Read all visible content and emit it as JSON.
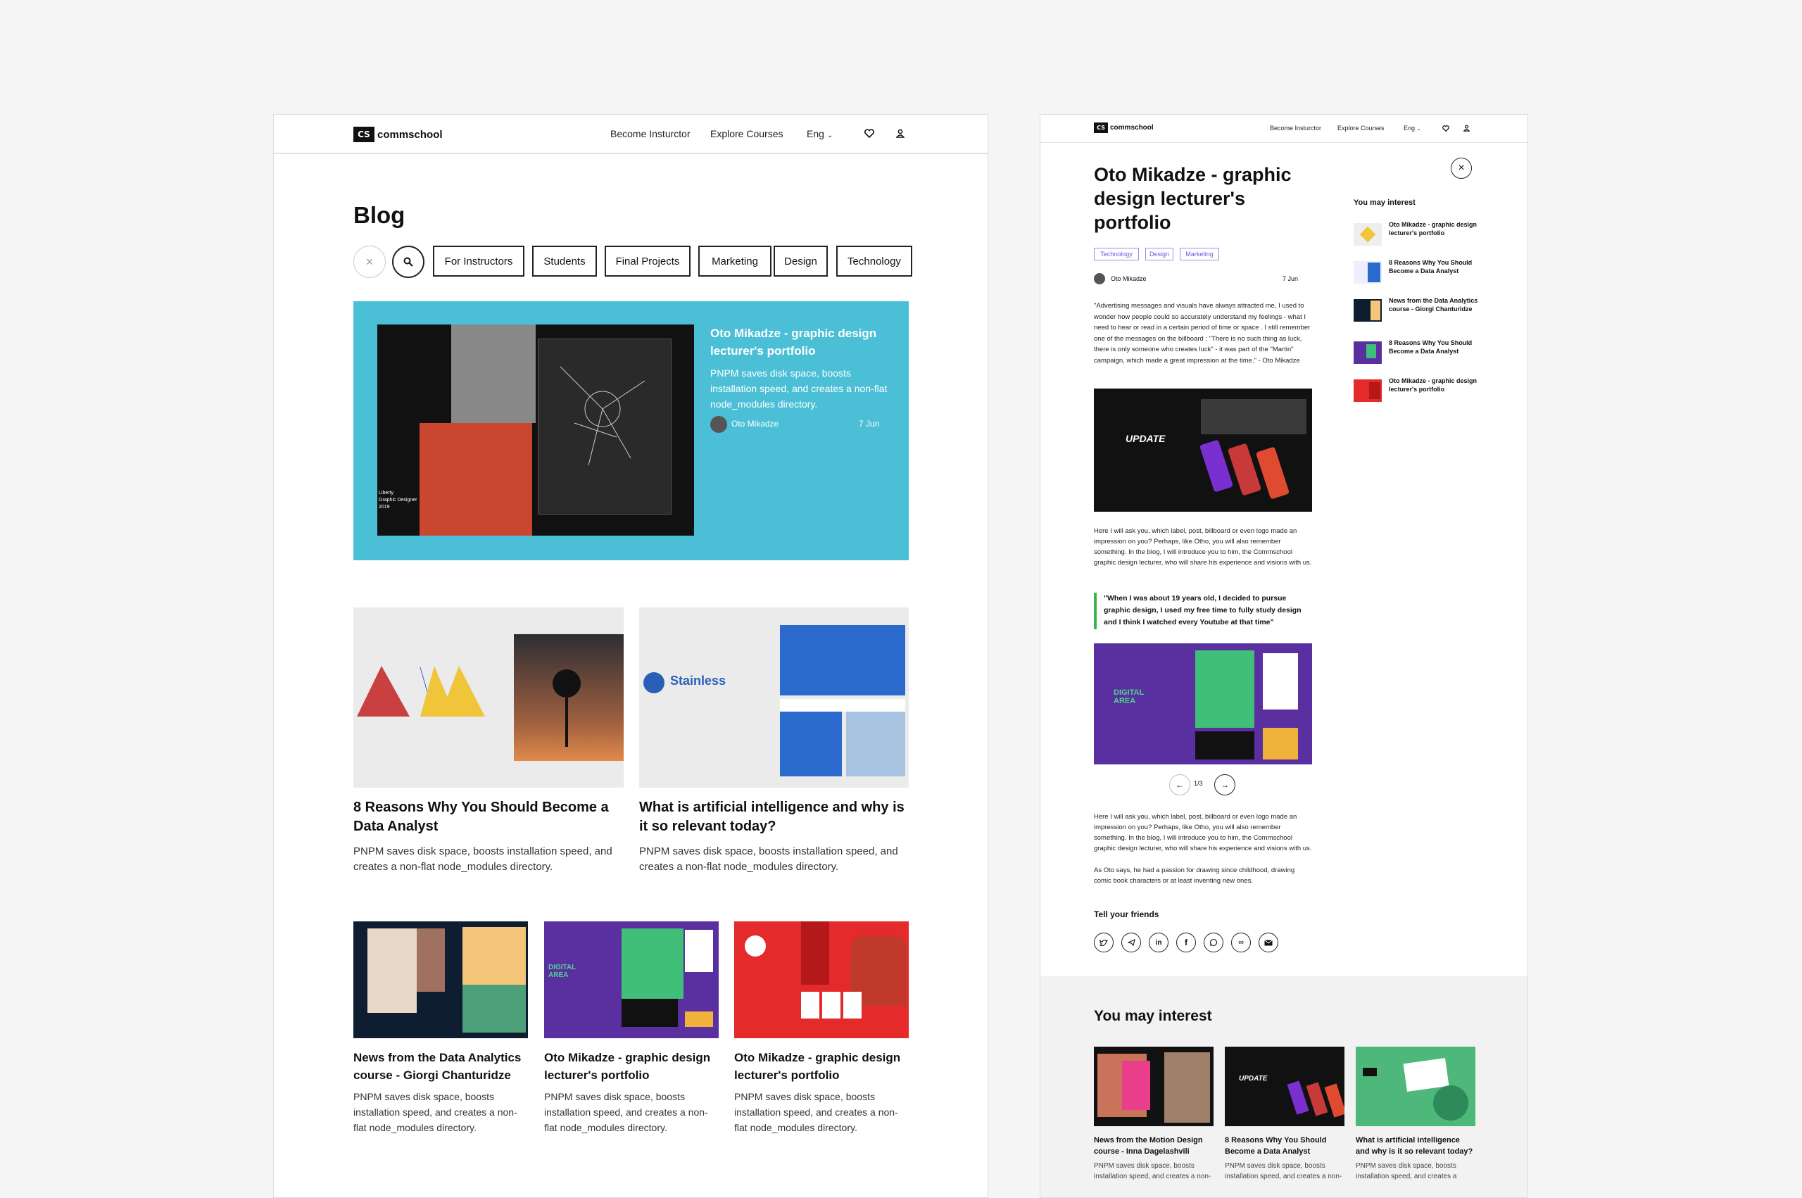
{
  "brand": {
    "mark": "CS",
    "name": "commschool"
  },
  "nav": {
    "become_instructor": "Become Insturctor",
    "explore_courses": "Explore Courses",
    "language": "Eng"
  },
  "blog": {
    "heading": "Blog",
    "filters": [
      "For Instructors",
      "Students",
      "Final Projects",
      "Marketing",
      "Design",
      "Technology"
    ],
    "featured": {
      "title": "Oto Mikadze - graphic design lecturer's portfolio",
      "desc": "PNPM saves disk space, boosts installation speed, and creates a non-flat node_modules directory.",
      "author": "Oto Mikadze",
      "date": "7 Jun",
      "poster_text": "Liberty\nGraphic Designer\n2019"
    },
    "row1": [
      {
        "title": "8 Reasons Why You Should Become a Data Analyst",
        "desc": "PNPM saves disk space, boosts installation speed, and creates a non-flat node_modules directory."
      },
      {
        "title": "What is artificial intelligence and why is it so relevant today?",
        "desc": "PNPM saves disk space, boosts installation speed, and creates a non-flat node_modules directory.",
        "image_label": "Stainless"
      }
    ],
    "row2": [
      {
        "title": "News from the Data Analytics course - Giorgi Chanturidze",
        "desc": "PNPM saves disk space, boosts installation speed, and creates a non-flat node_modules directory."
      },
      {
        "title": "Oto Mikadze - graphic design lecturer's portfolio",
        "desc": "PNPM saves disk space, boosts installation speed, and creates a non-flat node_modules directory.",
        "image_label": "DIGITAL AREA"
      },
      {
        "title": "Oto Mikadze - graphic design lecturer's portfolio",
        "desc": "PNPM saves disk space, boosts installation speed, and creates a non-flat node_modules directory."
      }
    ]
  },
  "article": {
    "title": "Oto Mikadze - graphic design lecturer's portfolio",
    "tags": [
      "Technology",
      "Design",
      "Marketing"
    ],
    "author": "Oto Mikadze",
    "date": "7 Jun",
    "para1": "\"Advertising messages and visuals have always attracted me, I used to wonder how people could so accurately understand my feelings - what I need to hear or read in a certain period of time or space . I still remember one of the messages on the billboard : \"There is no such thing as luck, there is only someone who creates luck\" - it was part of the \"Martin\" campaign, which made a great impression at the time.\" - Oto Mikadze",
    "image1_label": "UPDATE",
    "para2": "Here I will ask you, which label, post, billboard or even logo made an impression on you? Perhaps, like Otho, you will also remember something. In the blog, I will introduce you to him, the Commschool graphic design lecturer, who will share his experience and visions with us.",
    "quote": "\"When I was about 19 years old, I decided to pursue graphic design, I used my free time to fully study design and I think I watched every Youtube at that time\"",
    "image2_label": "DIGITAL AREA",
    "pager": "1/3",
    "para3": "Here I will ask you, which label, post, billboard or even logo made an impression on you? Perhaps, like Otho, you will also remember something. In the blog, I will introduce you to him, the Commschool graphic design lecturer, who will share his experience and visions with us.",
    "para4": "As Oto says, he had a passion for drawing since childhood, drawing comic book characters or at least inventing new ones.",
    "share_heading": "Tell your friends",
    "share_icons": [
      "twitter-icon",
      "telegram-icon",
      "linkedin-icon",
      "facebook-icon",
      "whatsapp-icon",
      "link-icon",
      "email-icon"
    ]
  },
  "sidebar": {
    "heading": "You may interest",
    "items": [
      "Oto Mikadze - graphic design lecturer's portfolio",
      "8 Reasons Why You Should Become a Data Analyst",
      "News from the Data Analytics course - Giorgi Chanturidze",
      "8 Reasons Why You Should Become a Data Analyst",
      "Oto Mikadze - graphic design lecturer's portfolio"
    ]
  },
  "bottom": {
    "heading": "You may interest",
    "cards": [
      {
        "title": "News from the Motion Design course - Inna Dagelashvili",
        "desc": "PNPM saves disk space, boosts installation speed, and creates a non-"
      },
      {
        "title": "8 Reasons Why You Should Become a Data Analyst",
        "desc": "PNPM saves disk space, boosts installation speed, and creates a non-",
        "image_label": "UPDATE"
      },
      {
        "title": "What is artificial intelligence and why is it so relevant today?",
        "desc": "PNPM saves disk space, boosts installation speed, and creates a"
      }
    ]
  },
  "colors": {
    "featured_bg": "#4bbfd6",
    "tag": "#6a55e0",
    "quote_bar": "#3bb54a",
    "purple": "#5a2fa0"
  }
}
